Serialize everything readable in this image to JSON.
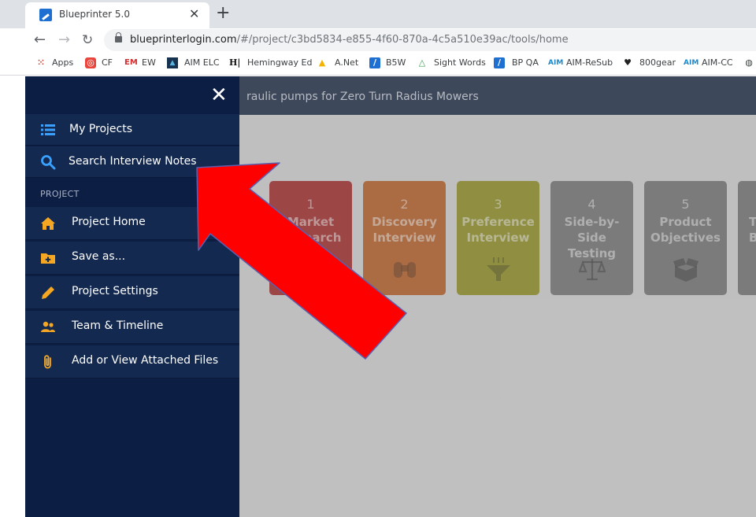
{
  "browser": {
    "tab_title": "Blueprinter 5.0",
    "tab_close": "✕",
    "new_tab": "+",
    "url_host": "blueprinterlogin.com",
    "url_path": "/#/project/c3bd5834-e855-4f60-870a-4c5a510e39ac/tools/home",
    "nav_back": "←",
    "nav_forward": "→",
    "nav_reload": "↻",
    "bookmarks": [
      {
        "label": "Apps",
        "icon": "apps-grid-icon"
      },
      {
        "label": "CF",
        "icon": "cf-icon"
      },
      {
        "label": "EW",
        "icon": "em-icon"
      },
      {
        "label": "AIM ELC",
        "icon": "aim-elc-icon"
      },
      {
        "label": "Hemingway Ed",
        "icon": "hemingway-icon"
      },
      {
        "label": "A.Net",
        "icon": "anet-icon"
      },
      {
        "label": "B5W",
        "icon": "b5w-icon"
      },
      {
        "label": "Sight Words",
        "icon": "sight-words-icon"
      },
      {
        "label": "BP QA",
        "icon": "bp-qa-icon"
      },
      {
        "label": "AIM-ReSub",
        "icon": "aim-resub-icon"
      },
      {
        "label": "800gear",
        "icon": "800gear-icon"
      },
      {
        "label": "AIM-CC",
        "icon": "aim-cc-icon"
      }
    ]
  },
  "header": {
    "project_title": "raulic pumps for Zero Turn Radius Mowers"
  },
  "drawer": {
    "close": "✕",
    "top_items": [
      {
        "label": "My Projects",
        "icon": "list-icon"
      },
      {
        "label": "Search Interview Notes",
        "icon": "search-icon"
      }
    ],
    "section_label": "PROJECT",
    "project_items": [
      {
        "label": "Project Home",
        "icon": "home-icon"
      },
      {
        "label": "Save as...",
        "icon": "folder-plus-icon"
      },
      {
        "label": "Project Settings",
        "icon": "pencil-icon"
      },
      {
        "label": "Team & Timeline",
        "icon": "team-icon"
      },
      {
        "label": "Add or View Attached Files",
        "icon": "paperclip-icon"
      }
    ]
  },
  "cards": [
    {
      "number": "1",
      "line1": "Market",
      "line2": "Research",
      "color": "#a21c1c",
      "icon": "binoculars-icon"
    },
    {
      "number": "2",
      "line1": "Discovery",
      "line2": "Interview",
      "color": "#b7561a",
      "icon": "binoculars-icon"
    },
    {
      "number": "3",
      "line1": "Preference",
      "line2": "Interview",
      "color": "#8c8a14",
      "icon": "funnel-icon"
    },
    {
      "number": "4",
      "line1": "Side-by-Side",
      "line2": "Testing",
      "color": "#6e6e6e",
      "icon": "scales-icon"
    },
    {
      "number": "5",
      "line1": "Product",
      "line2": "Objectives",
      "color": "#6e6e6e",
      "icon": "box-icon"
    },
    {
      "number": "T",
      "line1": "B",
      "line2": "",
      "color": "#6e6e6e",
      "icon": ""
    }
  ],
  "colors": {
    "drawer_bg": "#0d1e44",
    "drawer_item_bg": "#13294f",
    "accent_icon": "#f5a623",
    "search_icon": "#3aa0ff",
    "arrow": "#ff0000"
  }
}
